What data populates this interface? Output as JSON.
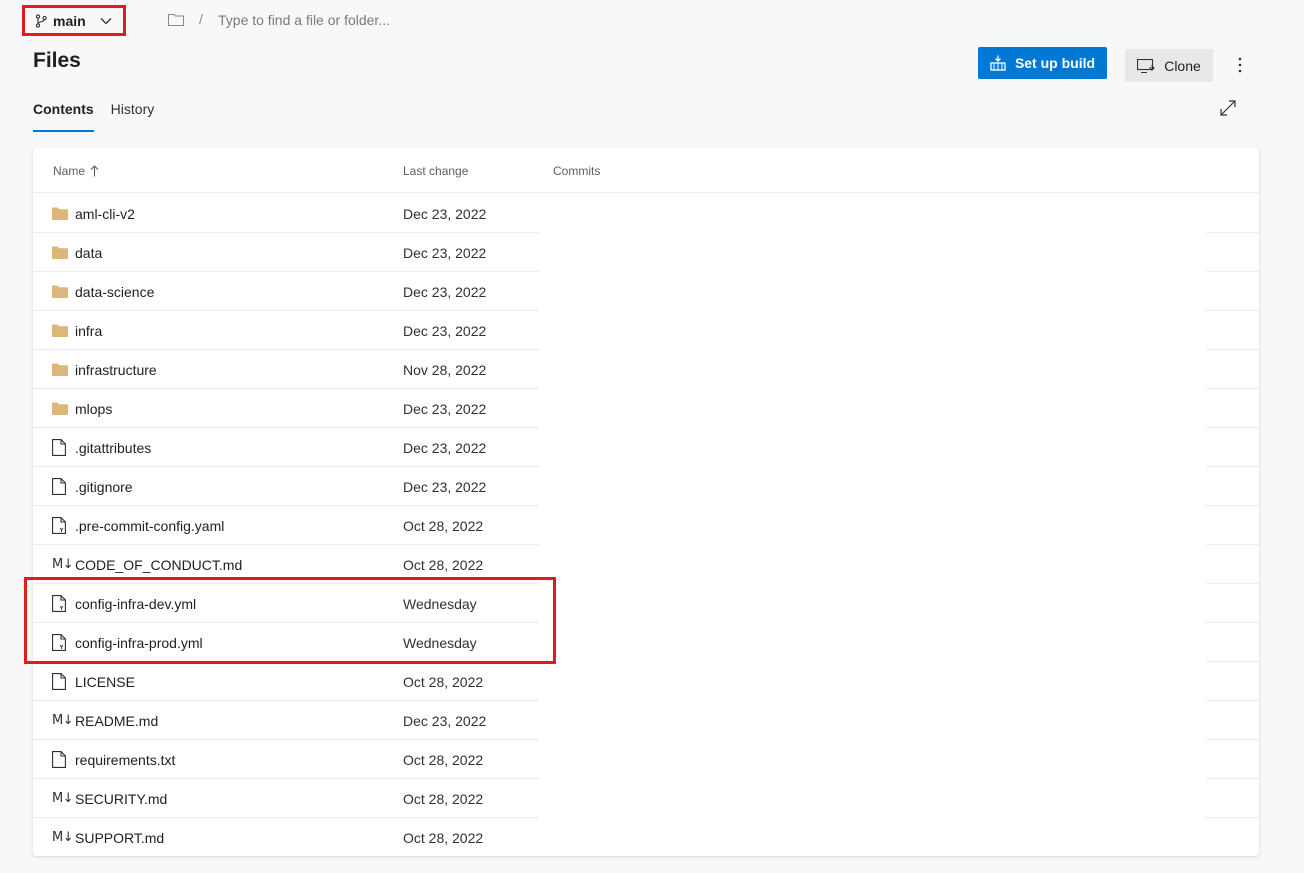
{
  "colors": {
    "accent": "#0078d4",
    "highlight_red": "#e01b1b",
    "folder": "#dcb67a"
  },
  "branch": {
    "name": "main",
    "icon": "branch-icon"
  },
  "path_search": {
    "separator": "/",
    "placeholder": "Type to find a file or folder..."
  },
  "page_title": "Files",
  "toolbar": {
    "setup_build_label": "Set up build",
    "clone_label": "Clone"
  },
  "tabs": [
    {
      "label": "Contents",
      "active": true
    },
    {
      "label": "History",
      "active": false
    }
  ],
  "table": {
    "columns": {
      "name": "Name",
      "last_change": "Last change",
      "commits": "Commits"
    },
    "sort": "name-ascending",
    "rows": [
      {
        "type": "folder",
        "name": "aml-cli-v2",
        "last_change": "Dec 23, 2022"
      },
      {
        "type": "folder",
        "name": "data",
        "last_change": "Dec 23, 2022"
      },
      {
        "type": "folder",
        "name": "data-science",
        "last_change": "Dec 23, 2022"
      },
      {
        "type": "folder",
        "name": "infra",
        "last_change": "Dec 23, 2022"
      },
      {
        "type": "folder",
        "name": "infrastructure",
        "last_change": "Nov 28, 2022"
      },
      {
        "type": "folder",
        "name": "mlops",
        "last_change": "Dec 23, 2022"
      },
      {
        "type": "file",
        "name": ".gitattributes",
        "last_change": "Dec 23, 2022"
      },
      {
        "type": "file",
        "name": ".gitignore",
        "last_change": "Dec 23, 2022"
      },
      {
        "type": "yaml",
        "name": ".pre-commit-config.yaml",
        "last_change": "Oct 28, 2022"
      },
      {
        "type": "markdown",
        "name": "CODE_OF_CONDUCT.md",
        "last_change": "Oct 28, 2022"
      },
      {
        "type": "yaml",
        "name": "config-infra-dev.yml",
        "last_change": "Wednesday"
      },
      {
        "type": "yaml",
        "name": "config-infra-prod.yml",
        "last_change": "Wednesday"
      },
      {
        "type": "file",
        "name": "LICENSE",
        "last_change": "Oct 28, 2022"
      },
      {
        "type": "markdown",
        "name": "README.md",
        "last_change": "Dec 23, 2022"
      },
      {
        "type": "file",
        "name": "requirements.txt",
        "last_change": "Oct 28, 2022"
      },
      {
        "type": "markdown",
        "name": "SECURITY.md",
        "last_change": "Oct 28, 2022"
      },
      {
        "type": "markdown",
        "name": "SUPPORT.md",
        "last_change": "Oct 28, 2022"
      }
    ]
  },
  "md_icon_text": "M↓"
}
